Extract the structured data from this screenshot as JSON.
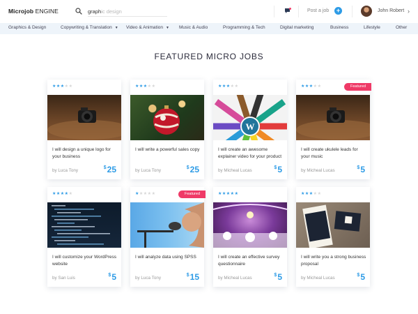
{
  "header": {
    "logo_bold": "Microjob",
    "logo_rest": " ENGINE",
    "search_typed": "graph",
    "search_rest": "ic design",
    "post_job": "Post a job",
    "plus": "+",
    "user_name": "John Robert",
    "icons": {
      "search": "search-icon",
      "message": "message-icon",
      "chevron": "chevron-right-icon"
    }
  },
  "categories": [
    {
      "label": "Graphics & Design",
      "dropdown": false
    },
    {
      "label": "Copywriting & Translation",
      "dropdown": true
    },
    {
      "label": "Video & Animation",
      "dropdown": true
    },
    {
      "label": "Music & Audio",
      "dropdown": false
    },
    {
      "label": "Programming & Tech",
      "dropdown": false
    },
    {
      "label": "Digital marketing",
      "dropdown": false
    },
    {
      "label": "Business",
      "dropdown": false
    },
    {
      "label": "Lifestyle",
      "dropdown": false
    },
    {
      "label": "Other",
      "dropdown": false
    }
  ],
  "section_title": "FEATURED MICRO JOBS",
  "featured_label": "Featured",
  "currency": "$",
  "colors": {
    "accent": "#2d9be6",
    "featured": "#ef3a67",
    "catbar": "#eef4fa"
  },
  "jobs": [
    {
      "title": "I will design a unique logo for your business",
      "by": "by Luca Tony",
      "price": "25",
      "rating": 3,
      "featured": false,
      "image": "camera"
    },
    {
      "title": "I will write a powerful sales copy",
      "by": "by Luca Tony",
      "price": "25",
      "rating": 3,
      "featured": false,
      "image": "xmas-ornament"
    },
    {
      "title": "I will create an awesome explainer video for your product",
      "by": "by Micheal Lucas",
      "price": "5",
      "rating": 3,
      "featured": false,
      "image": "pencils-wordpress"
    },
    {
      "title": "I will create ukulele leads for your music",
      "by": "by Micheal Lucas",
      "price": "5",
      "rating": 3,
      "featured": true,
      "image": "camera"
    },
    {
      "title": "I will customize your WordPress website",
      "by": "by San Luis",
      "price": "5",
      "rating": 4,
      "featured": false,
      "image": "code-screen"
    },
    {
      "title": "I will analyze data using SPSS",
      "by": "by Luca Tony",
      "price": "15",
      "rating": 1,
      "featured": true,
      "image": "microphone"
    },
    {
      "title": "I will create an effective survey questionnaire",
      "by": "by Micheal Lucas",
      "price": "5",
      "rating": 5,
      "featured": false,
      "image": "event-hall"
    },
    {
      "title": "I will write you a strong business proposal",
      "by": "by Micheal Lucas",
      "price": "5",
      "rating": 3,
      "featured": false,
      "image": "business-cards"
    }
  ]
}
